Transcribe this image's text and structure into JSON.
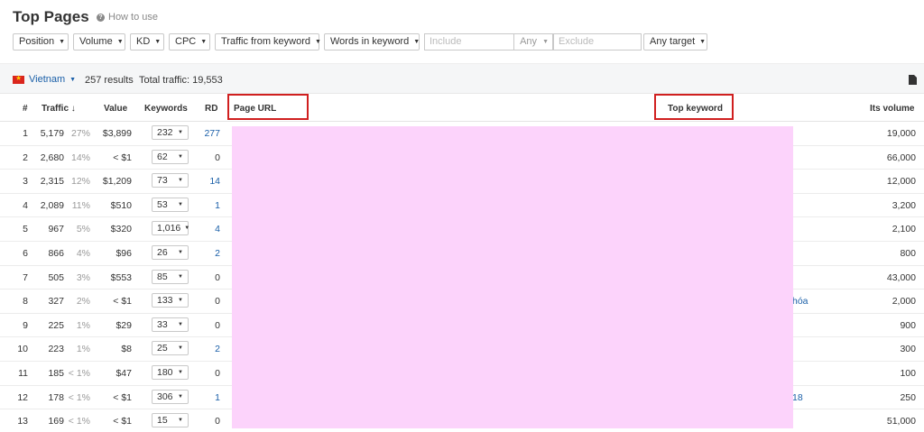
{
  "page": {
    "title": "Top Pages",
    "how_to_use": "How to use"
  },
  "filters": {
    "position": "Position",
    "volume": "Volume",
    "kd": "KD",
    "cpc": "CPC",
    "traffic_from_keyword": "Traffic from keyword",
    "words_in_keyword": "Words in keyword",
    "include_placeholder": "Include",
    "include_mode": "Any",
    "exclude_placeholder": "Exclude",
    "target": "Any target"
  },
  "summary": {
    "country": "Vietnam",
    "results": "257 results",
    "total_traffic": "Total traffic: 19,553"
  },
  "table": {
    "headers": {
      "num": "#",
      "traffic": "Traffic ↓",
      "value": "Value",
      "keywords": "Keywords",
      "rd": "RD",
      "page_url": "Page URL",
      "top_keyword": "Top keyword",
      "its_volume": "Its volume"
    },
    "rows": [
      {
        "num": "1",
        "traffic": "5,179",
        "pct": "27%",
        "value": "$3,899",
        "keywords": "232",
        "rd": "277",
        "rd_link": true,
        "top_keyword": "",
        "volume": "19,000"
      },
      {
        "num": "2",
        "traffic": "2,680",
        "pct": "14%",
        "value": "< $1",
        "keywords": "62",
        "rd": "0",
        "rd_link": false,
        "top_keyword": "",
        "volume": "66,000"
      },
      {
        "num": "3",
        "traffic": "2,315",
        "pct": "12%",
        "value": "$1,209",
        "keywords": "73",
        "rd": "14",
        "rd_link": true,
        "top_keyword": "",
        "volume": "12,000"
      },
      {
        "num": "4",
        "traffic": "2,089",
        "pct": "11%",
        "value": "$510",
        "keywords": "53",
        "rd": "1",
        "rd_link": true,
        "top_keyword": "",
        "volume": "3,200"
      },
      {
        "num": "5",
        "traffic": "967",
        "pct": "5%",
        "value": "$320",
        "keywords": "1,016",
        "rd": "4",
        "rd_link": true,
        "top_keyword": "",
        "volume": "2,100"
      },
      {
        "num": "6",
        "traffic": "866",
        "pct": "4%",
        "value": "$96",
        "keywords": "26",
        "rd": "2",
        "rd_link": true,
        "top_keyword": "",
        "volume": "800"
      },
      {
        "num": "7",
        "traffic": "505",
        "pct": "3%",
        "value": "$553",
        "keywords": "85",
        "rd": "0",
        "rd_link": false,
        "top_keyword": "",
        "volume": "43,000"
      },
      {
        "num": "8",
        "traffic": "327",
        "pct": "2%",
        "value": "< $1",
        "keywords": "133",
        "rd": "0",
        "rd_link": false,
        "top_keyword": "hóa",
        "volume": "2,000"
      },
      {
        "num": "9",
        "traffic": "225",
        "pct": "1%",
        "value": "$29",
        "keywords": "33",
        "rd": "0",
        "rd_link": false,
        "top_keyword": "",
        "volume": "900"
      },
      {
        "num": "10",
        "traffic": "223",
        "pct": "1%",
        "value": "$8",
        "keywords": "25",
        "rd": "2",
        "rd_link": true,
        "top_keyword": "",
        "volume": "300"
      },
      {
        "num": "11",
        "traffic": "185",
        "pct": "< 1%",
        "value": "$47",
        "keywords": "180",
        "rd": "0",
        "rd_link": false,
        "top_keyword": "",
        "volume": "100"
      },
      {
        "num": "12",
        "traffic": "178",
        "pct": "< 1%",
        "value": "< $1",
        "keywords": "306",
        "rd": "1",
        "rd_link": true,
        "top_keyword": "18",
        "volume": "250"
      },
      {
        "num": "13",
        "traffic": "169",
        "pct": "< 1%",
        "value": "< $1",
        "keywords": "15",
        "rd": "0",
        "rd_link": false,
        "top_keyword": "",
        "volume": "51,000"
      }
    ]
  },
  "colors": {
    "link": "#1a5fa8",
    "highlight_box": "#d01f1f",
    "masked_area": "#fcd3fb"
  }
}
